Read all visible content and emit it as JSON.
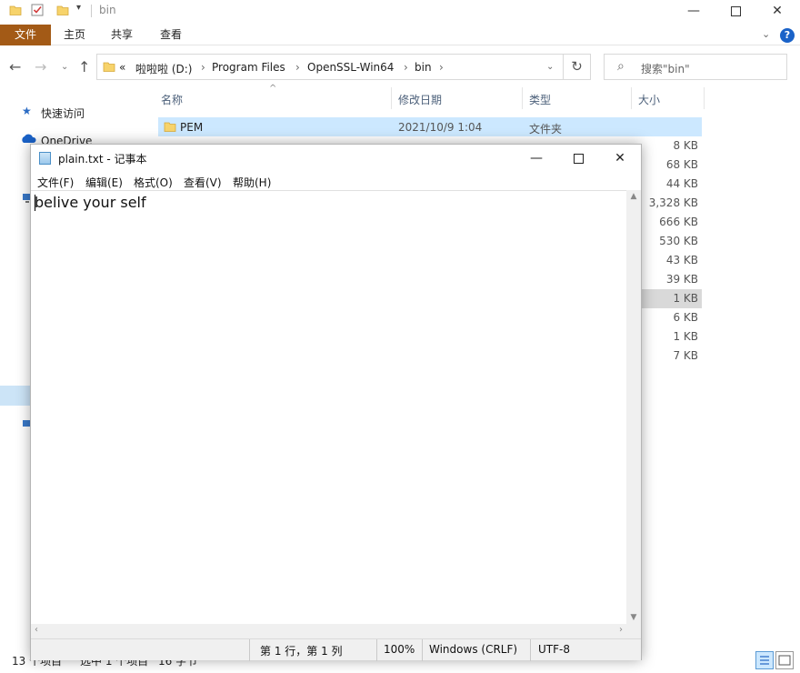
{
  "explorer": {
    "title": "bin",
    "ribbon_tabs": [
      "文件",
      "主页",
      "共享",
      "查看"
    ],
    "help_label": "?",
    "address": {
      "overflow": "«",
      "crumbs": [
        "啦啦啦 (D:)",
        "Program Files",
        "OpenSSL-Win64",
        "bin"
      ]
    },
    "search_placeholder": "搜索\"bin\"",
    "sidebar": {
      "quick_access": "快速访问",
      "onedrive": "OneDrive"
    },
    "columns": {
      "name": "名称",
      "modified": "修改日期",
      "type": "类型",
      "size": "大小"
    },
    "first_row": {
      "name": "PEM",
      "modified": "2021/10/9 1:04",
      "type": "文件夹"
    },
    "sizes": [
      "8 KB",
      "68 KB",
      "44 KB",
      "3,328 KB",
      "666 KB",
      "530 KB",
      "43 KB",
      "39 KB",
      "1 KB",
      "6 KB",
      "1 KB",
      "7 KB"
    ],
    "status": {
      "count": "13 个项目",
      "selected": "选中 1 个项目",
      "bytes": "16 字节"
    }
  },
  "notepad": {
    "title": "plain.txt - 记事本",
    "menu": [
      "文件(F)",
      "编辑(E)",
      "格式(O)",
      "查看(V)",
      "帮助(H)"
    ],
    "content": "belive your self",
    "status": {
      "position": "第 1 行，第 1 列",
      "zoom": "100%",
      "line_ending": "Windows (CRLF)",
      "encoding": "UTF-8"
    }
  },
  "colors": {
    "file_tab": "#a35a16",
    "selection": "#cce8ff",
    "help": "#1a62c8",
    "folder": "#f7d36b"
  }
}
